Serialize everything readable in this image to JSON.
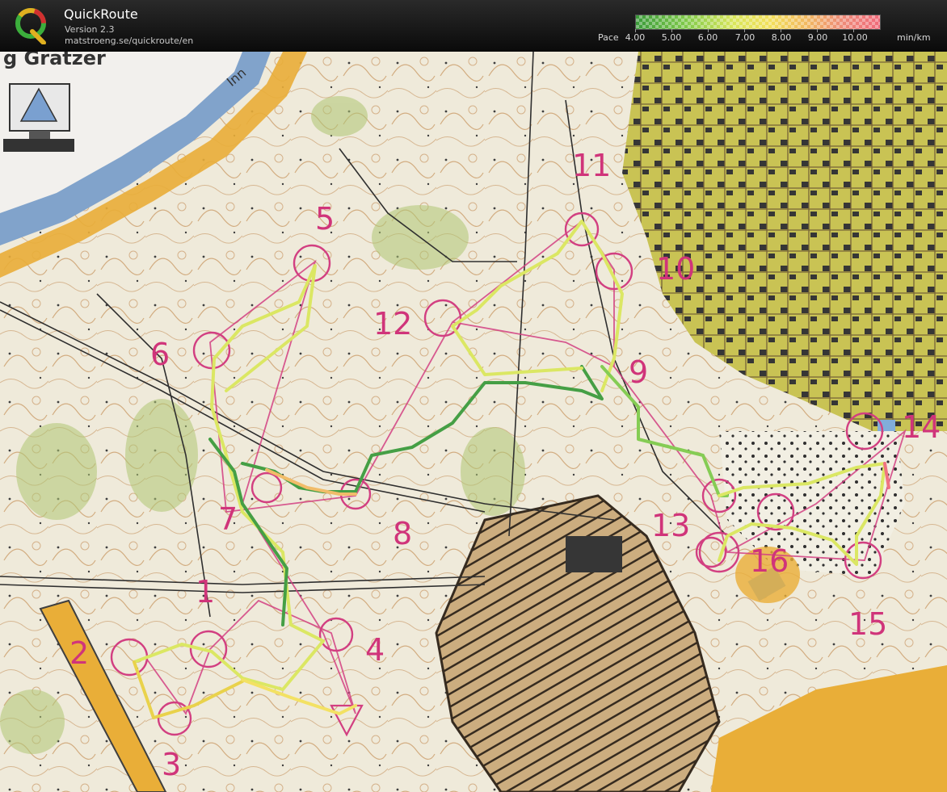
{
  "app": {
    "title": "QuickRoute",
    "version": "Version 2.3",
    "url": "matstroeng.se/quickroute/en",
    "logo_icon": "quickroute-q-logo-icon"
  },
  "pace_scale": {
    "label": "Pace",
    "unit": "min/km",
    "values": [
      "4.00",
      "5.00",
      "6.00",
      "7.00",
      "8.00",
      "9.00",
      "10.00"
    ],
    "colors": {
      "fast": "#3a9a3a",
      "medium": "#f3e05a",
      "slow": "#f06a7a"
    }
  },
  "map": {
    "header_text": "g Gratzer",
    "river_label": "Inn",
    "controls": [
      "1",
      "2",
      "3",
      "4",
      "5",
      "6",
      "7",
      "8",
      "9",
      "10",
      "11",
      "12",
      "13",
      "14",
      "15",
      "16"
    ],
    "colors": {
      "course": "#d0347a",
      "water": "#7a9ec8",
      "open": "#e8a92c",
      "vegetation": "#a9c26b",
      "contour": "#b5722e",
      "building": "#2a2a2a"
    }
  }
}
